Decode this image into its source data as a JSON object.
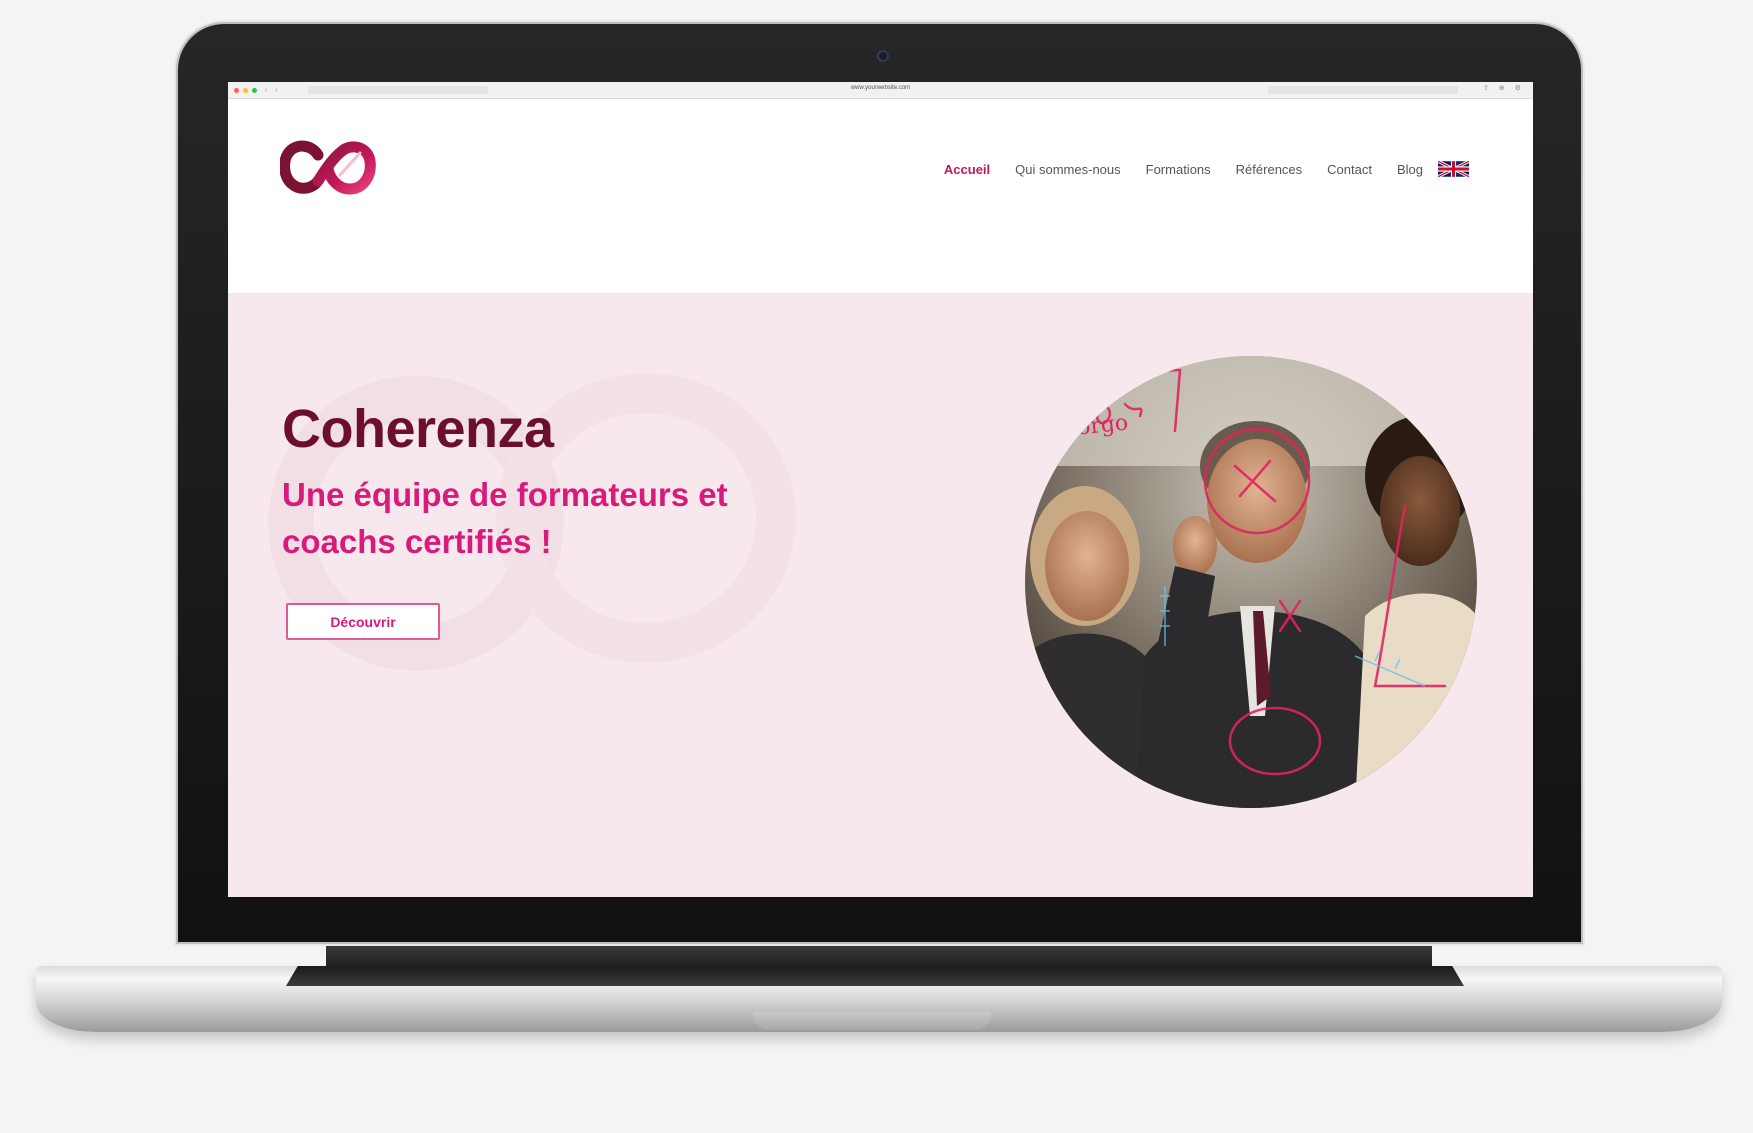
{
  "browser": {
    "url": "www.yourwebsite.com"
  },
  "site": {
    "nav": [
      {
        "label": "Accueil",
        "active": true
      },
      {
        "label": "Qui sommes-nous",
        "active": false
      },
      {
        "label": "Formations",
        "active": false
      },
      {
        "label": "Références",
        "active": false
      },
      {
        "label": "Contact",
        "active": false
      },
      {
        "label": "Blog",
        "active": false
      }
    ],
    "language_flag_icon": "uk-flag-icon"
  },
  "hero": {
    "title": "Coherenza",
    "subtitle": "Une équipe de formateurs et coachs certifiés !",
    "cta_label": "Découvrir",
    "photo_annotation": "Torgo"
  },
  "colors": {
    "brand_dark": "#6b0f2c",
    "brand_pink": "#d81b7a",
    "hero_bg": "#f6e8ec"
  }
}
